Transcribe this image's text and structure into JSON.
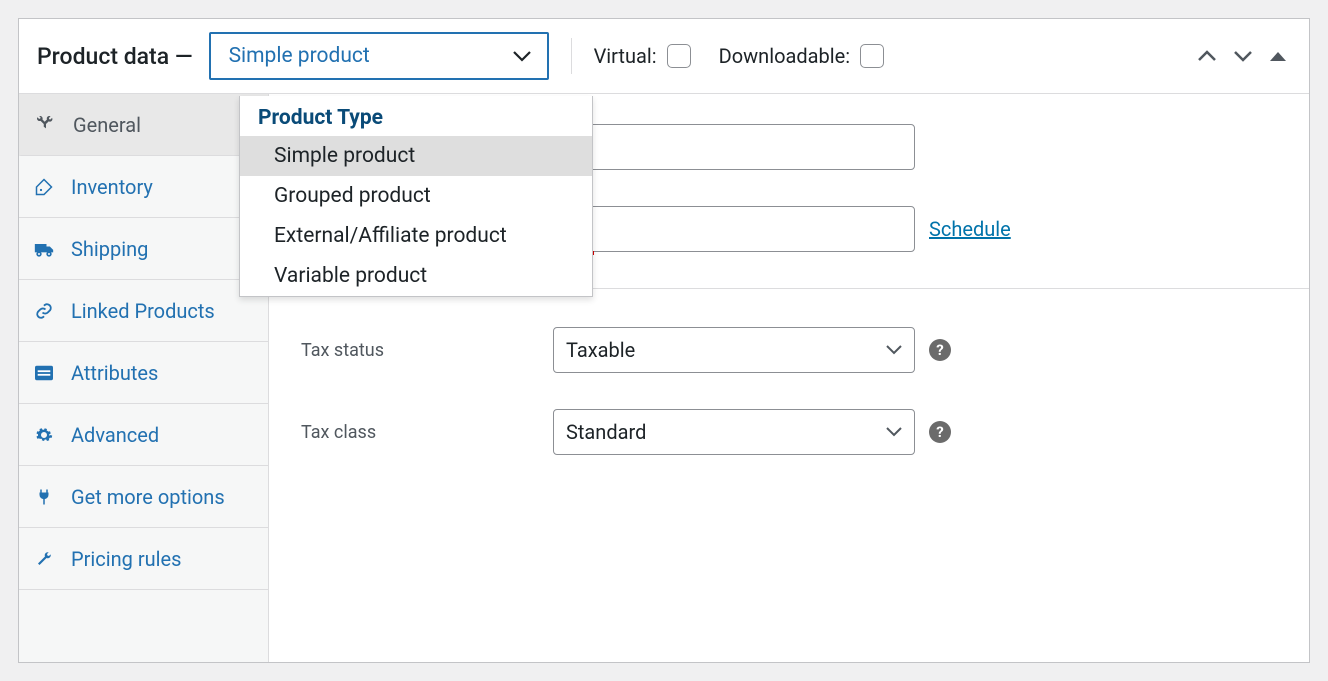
{
  "header": {
    "title": "Product data —",
    "select_value": "Simple product",
    "virtual_label": "Virtual:",
    "downloadable_label": "Downloadable:"
  },
  "dropdown": {
    "heading": "Product Type",
    "options": [
      {
        "label": "Simple product",
        "selected": true
      },
      {
        "label": "Grouped product",
        "selected": false
      },
      {
        "label": "External/Affiliate product",
        "selected": false
      },
      {
        "label": "Variable product",
        "selected": false
      }
    ]
  },
  "tabs": [
    {
      "label": "General",
      "active": true
    },
    {
      "label": "Inventory",
      "active": false
    },
    {
      "label": "Shipping",
      "active": false
    },
    {
      "label": "Linked Products",
      "active": false
    },
    {
      "label": "Attributes",
      "active": false
    },
    {
      "label": "Advanced",
      "active": false
    },
    {
      "label": "Get more options",
      "active": false
    },
    {
      "label": "Pricing rules",
      "active": false
    }
  ],
  "main": {
    "schedule_link": "Schedule",
    "tax_status": {
      "label": "Tax status",
      "value": "Taxable"
    },
    "tax_class": {
      "label": "Tax class",
      "value": "Standard"
    }
  }
}
